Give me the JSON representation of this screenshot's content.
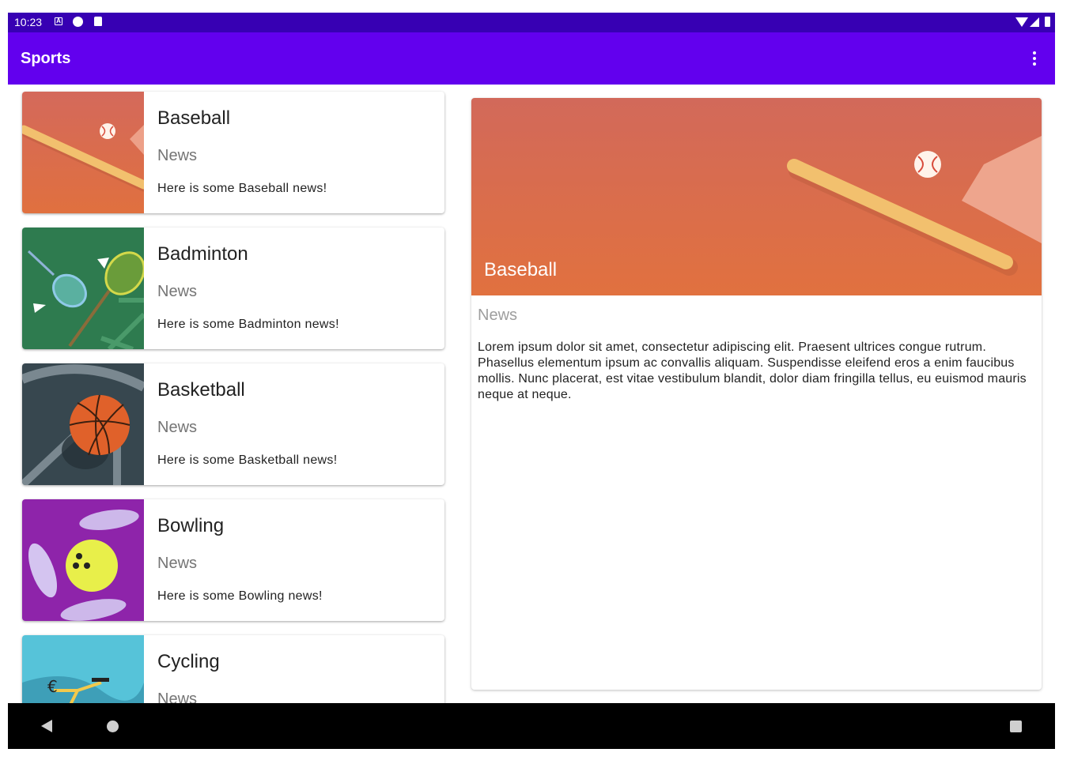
{
  "status_bar": {
    "time": "10:23",
    "left_icons": [
      "a-notification-icon",
      "circle-notification-icon",
      "sd-card-icon"
    ],
    "right_icons": [
      "wifi-icon",
      "signal-icon",
      "battery-icon"
    ]
  },
  "app_bar": {
    "title": "Sports",
    "menu_icon": "more-vert-icon",
    "background": "#6200ee",
    "status_background": "#3700b3"
  },
  "list": [
    {
      "title": "Baseball",
      "subtitle": "News",
      "body": "Here is some Baseball news!",
      "image": "baseball-image"
    },
    {
      "title": "Badminton",
      "subtitle": "News",
      "body": "Here is some Badminton news!",
      "image": "badminton-image"
    },
    {
      "title": "Basketball",
      "subtitle": "News",
      "body": "Here is some Basketball news!",
      "image": "basketball-image"
    },
    {
      "title": "Bowling",
      "subtitle": "News",
      "body": "Here is some Bowling news!",
      "image": "bowling-image"
    },
    {
      "title": "Cycling",
      "subtitle": "News",
      "body": "",
      "image": "cycling-image"
    }
  ],
  "detail": {
    "title": "Baseball",
    "subtitle": "News",
    "body": "Lorem ipsum dolor sit amet, consectetur adipiscing elit. Praesent ultrices congue rutrum. Phasellus elementum ipsum ac convallis aliquam. Suspendisse eleifend eros a enim faucibus mollis. Nunc placerat, est vitae vestibulum blandit, dolor diam fringilla tellus, eu euismod mauris neque at neque.",
    "image": "baseball-image"
  },
  "nav_bar": {
    "icons": [
      "back-icon",
      "home-icon",
      "recents-icon"
    ]
  }
}
